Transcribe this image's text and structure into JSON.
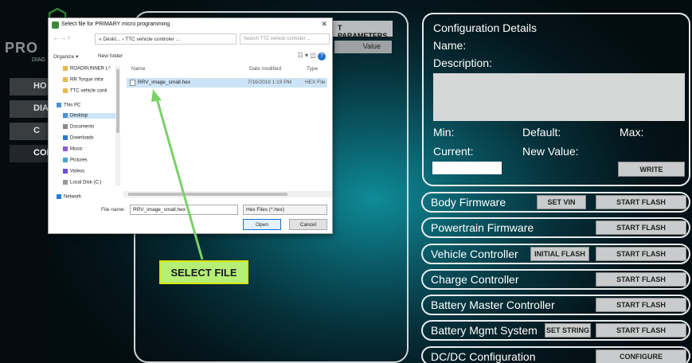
{
  "app": {
    "brand": "PRO",
    "brand_sub": "DIAG",
    "nav": [
      {
        "label": "HO"
      },
      {
        "label": "DIA"
      },
      {
        "label": "C"
      },
      {
        "label": "CON"
      }
    ]
  },
  "params": {
    "header_button": "T PARAMETERS",
    "value_header": "Value"
  },
  "config": {
    "title": "Configuration Details",
    "name_label": "Name:",
    "description_label": "Description:",
    "min_label": "Min:",
    "default_label": "Default:",
    "max_label": "Max:",
    "current_label": "Current:",
    "new_value_label": "New Value:",
    "write_button": "WRITE"
  },
  "firmware_rows": [
    {
      "label": "Body Firmware",
      "secondary_button": "SET VIN",
      "primary_button": "START FLASH"
    },
    {
      "label": "Powertrain Firmware",
      "primary_button": "START FLASH"
    },
    {
      "label": "Vehicle Controller",
      "secondary_button": "INITIAL FLASH",
      "primary_button": "START FLASH"
    },
    {
      "label": "Charge Controller",
      "primary_button": "START FLASH"
    },
    {
      "label": "Battery Master Controller",
      "primary_button": "START FLASH"
    },
    {
      "label": "Battery Mgmt System",
      "secondary_button": "SET STRING",
      "primary_button": "START FLASH"
    },
    {
      "label": "DC/DC Configuration",
      "primary_button": "CONFIGURE"
    }
  ],
  "dialog": {
    "title": "Select file for PRIMARY micro programming",
    "close": "✕",
    "nav_arrows": "← → ↑",
    "path": "« Deskt... › TTC vehicle controler ...",
    "search_placeholder": "Search TTC vehicle controler ...",
    "organize": "Organize ▾",
    "new_folder": "New folder",
    "view_icons": "☷ ▾  ◫",
    "help": "?",
    "tree": [
      {
        "label": "ROADRUNNER L^",
        "icon_color": "#e8b84a"
      },
      {
        "label": "RR Torque infor",
        "icon_color": "#e8b84a"
      },
      {
        "label": "TTC vehicle conti",
        "icon_color": "#e8b84a"
      },
      {
        "label": "This PC",
        "icon_color": "#4a90d9"
      },
      {
        "label": "Desktop",
        "icon_color": "#4a90d9"
      },
      {
        "label": "Documents",
        "icon_color": "#8a8a8a"
      },
      {
        "label": "Downloads",
        "icon_color": "#2a7ad9"
      },
      {
        "label": "Music",
        "icon_color": "#8a5ad9"
      },
      {
        "label": "Pictures",
        "icon_color": "#4aa0d9"
      },
      {
        "label": "Videos",
        "icon_color": "#6a4ad9"
      },
      {
        "label": "Local Disk (C:)",
        "icon_color": "#999999"
      },
      {
        "label": "Network",
        "icon_color": "#2a7ad9"
      }
    ],
    "columns": {
      "name": "Name",
      "date": "Date modified",
      "type": "Type"
    },
    "files": [
      {
        "name": "RRV_image_small.hex",
        "date": "7/16/2019 1:19 PM",
        "type": "HEX File"
      }
    ],
    "filename_label": "File name:",
    "filename_value": "RRV_image_small.hex",
    "filetype_value": "Hex Files (*.hex)",
    "open_button": "Open",
    "cancel_button": "Cancel"
  },
  "callout": {
    "text": "SELECT FILE",
    "color": "#b5ef76",
    "arrow_color": "#7bd06a"
  }
}
